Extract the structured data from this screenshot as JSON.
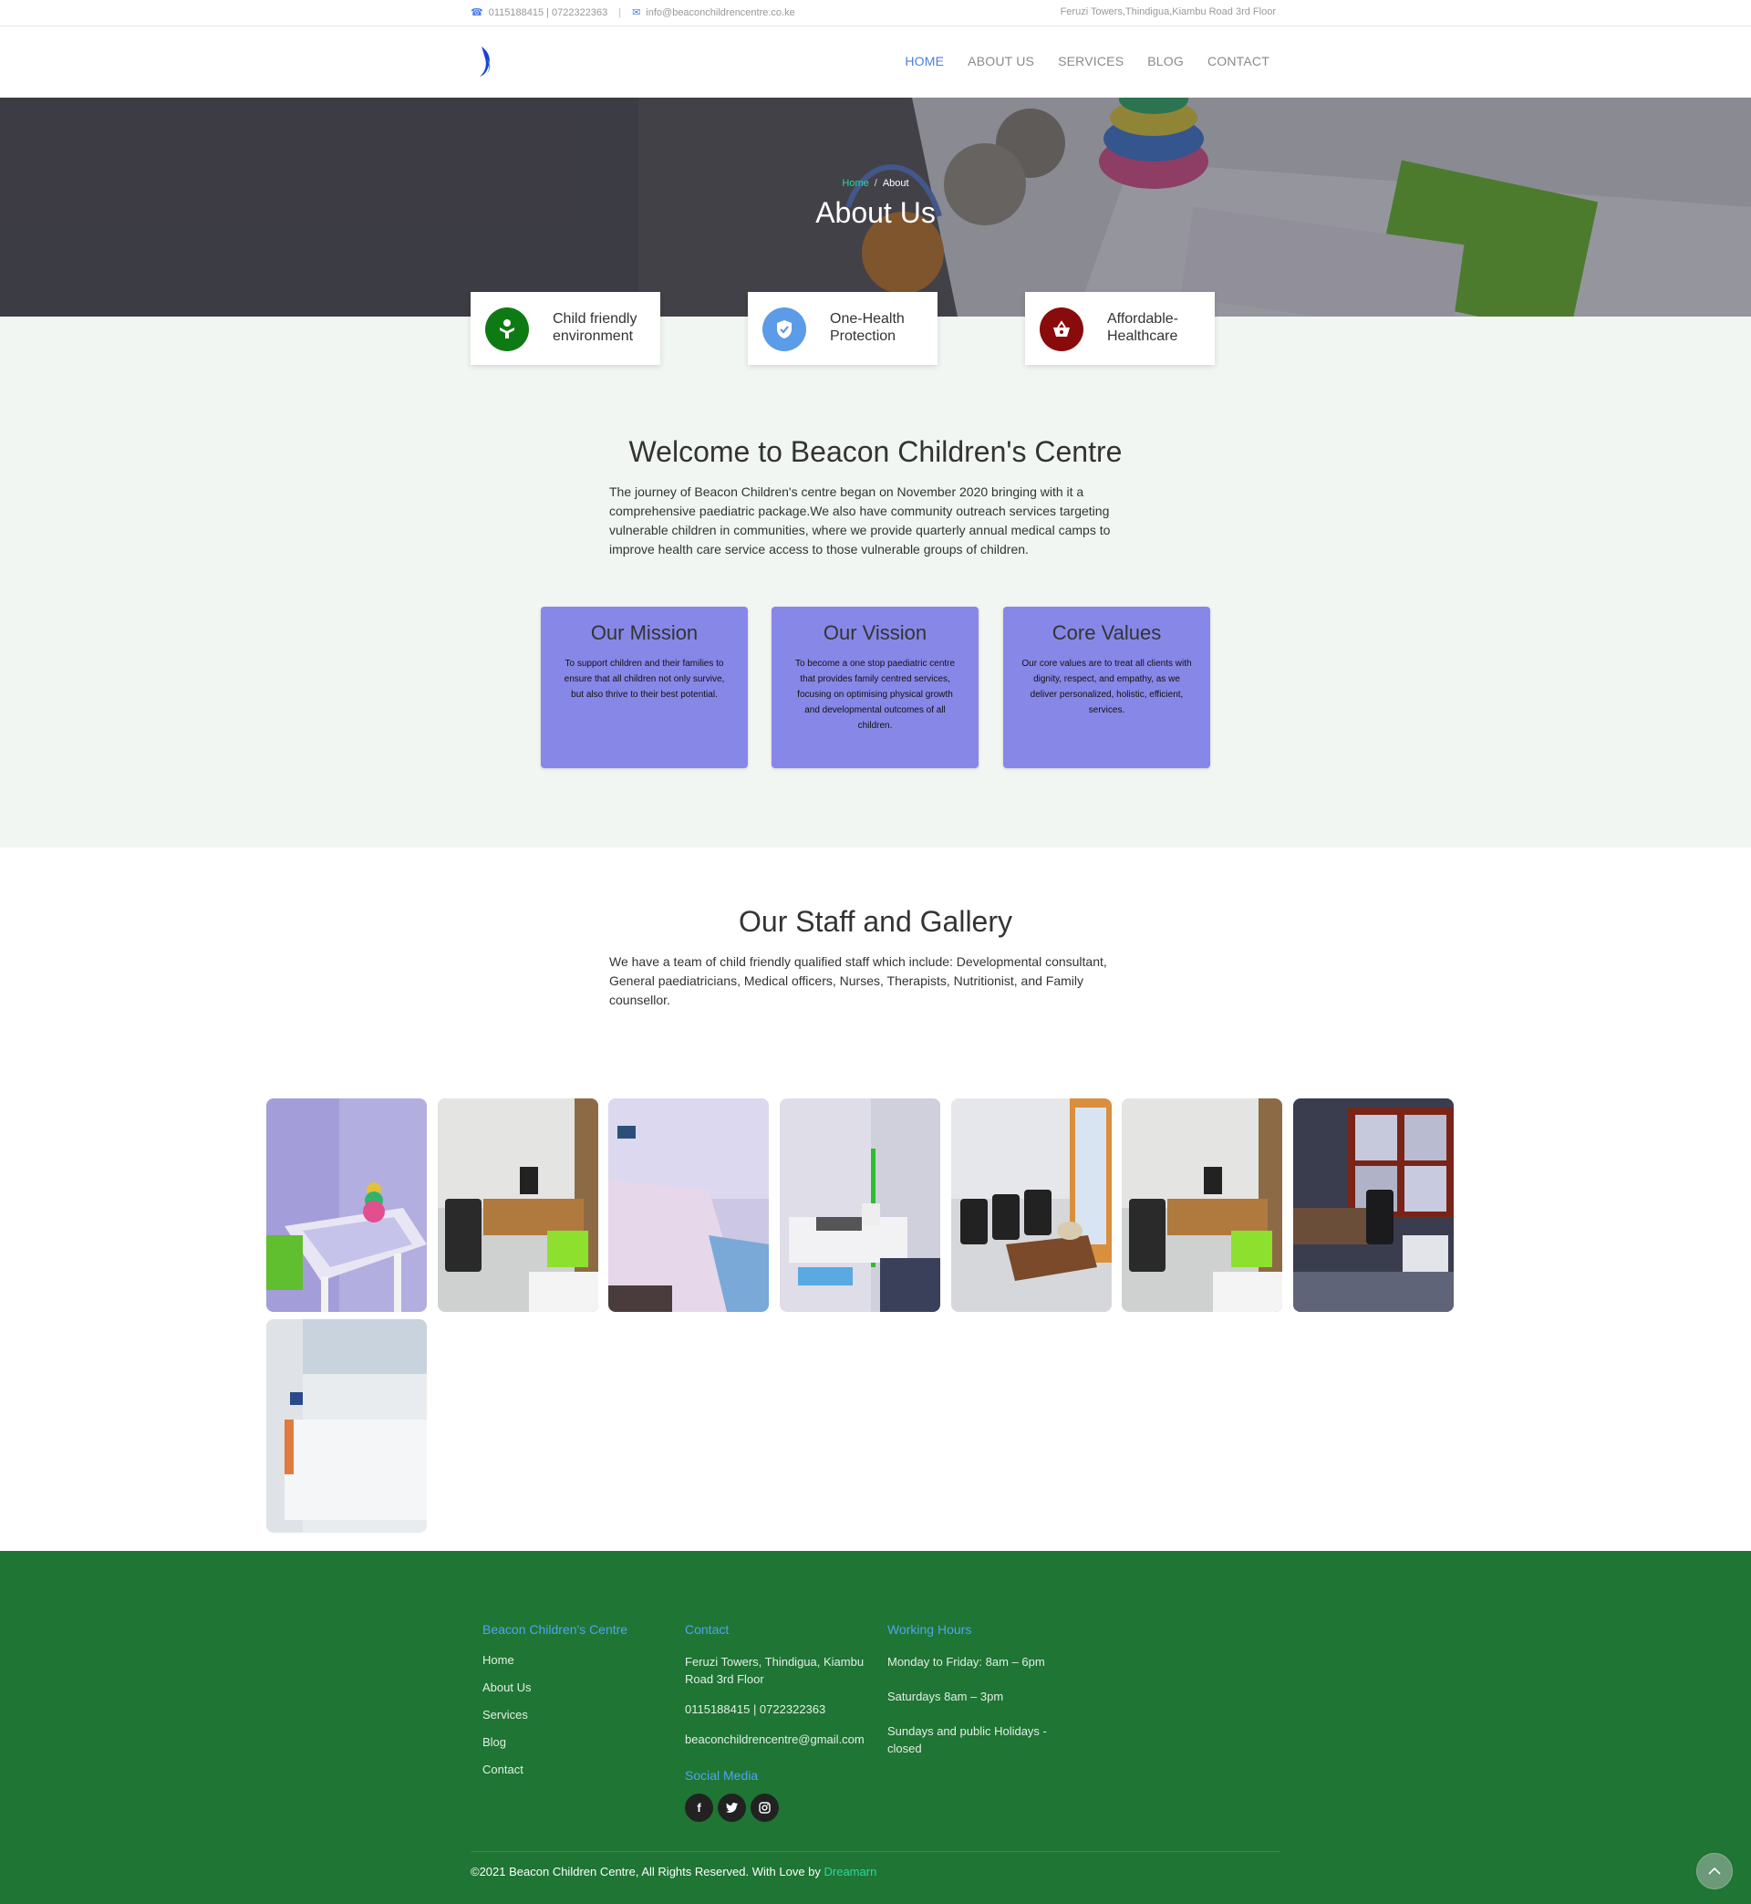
{
  "topbar": {
    "phones": "0115188415 | 0722322363",
    "email": "info@beaconchildrencentre.co.ke",
    "address": "Feruzi Towers,Thindigua,Kiambu Road 3rd Floor"
  },
  "nav": {
    "items": [
      {
        "label": "HOME",
        "active": true
      },
      {
        "label": "ABOUT US",
        "active": false
      },
      {
        "label": "SERVICES",
        "active": false
      },
      {
        "label": "BLOG",
        "active": false
      },
      {
        "label": "CONTACT",
        "active": false
      }
    ]
  },
  "hero": {
    "breadcrumb_home": "Home",
    "breadcrumb_sep": "/",
    "breadcrumb_current": "About",
    "title": "About Us"
  },
  "features": [
    {
      "line1": "Child friendly",
      "line2": "environment",
      "icon": "child-icon",
      "color": "#0e7a14"
    },
    {
      "line1": "One-Health",
      "line2": "Protection",
      "icon": "shield-icon",
      "color": "#5b9be8"
    },
    {
      "line1": "Affordable-",
      "line2": "Healthcare",
      "icon": "basket-icon",
      "color": "#8a0b0b"
    }
  ],
  "welcome": {
    "title": "Welcome to Beacon Children's Centre",
    "text": "The journey of Beacon Children's centre began on November 2020 bringing with it a comprehensive paediatric package.We also have community outreach services targeting vulnerable children in communities, where we provide quarterly annual medical camps to improve health care service access to those vulnerable groups of children."
  },
  "values": [
    {
      "title": "Our Mission",
      "text": "To support children and their families to ensure that all children not only survive, but also thrive to their best potential."
    },
    {
      "title": "Our Vission",
      "text": "To become a one stop paediatric centre that provides family centred services, focusing on optimising physical growth and developmental outcomes of all children."
    },
    {
      "title": "Core Values",
      "text": "Our core values are to treat all clients with dignity, respect, and empathy, as we deliver personalized, holistic, efficient, services."
    }
  ],
  "staff": {
    "title": "Our Staff and Gallery",
    "text": "We have a team of child friendly qualified staff which include: Developmental consultant, General paediatricians, Medical officers, Nurses, Therapists, Nutritionist, and Family counsellor."
  },
  "footer": {
    "col1_title": "Beacon Children's Centre",
    "links": [
      "Home",
      "About Us",
      "Services",
      "Blog",
      "Contact"
    ],
    "col2_title": "Contact",
    "address": "Feruzi Towers, Thindigua, Kiambu Road 3rd Floor",
    "phones": "0115188415 | 0722322363",
    "email": "beaconchildrencentre@gmail.com",
    "social_title": "Social Media",
    "social": [
      "f",
      "t",
      "ig"
    ],
    "col3_title": "Working Hours",
    "hours": [
      "Monday to Friday: 8am – 6pm",
      "Saturdays 8am – 3pm",
      "Sundays and public Holidays - closed"
    ],
    "copyright": "©2021 Beacon Children Centre, All Rights Reserved. With Love by ",
    "credit": "Dreamarn"
  },
  "colors": {
    "accent": "#4a7ee8",
    "footer_bg": "#1f7533",
    "card_bg": "#8787e8",
    "band_bg": "#f1f6f2"
  }
}
